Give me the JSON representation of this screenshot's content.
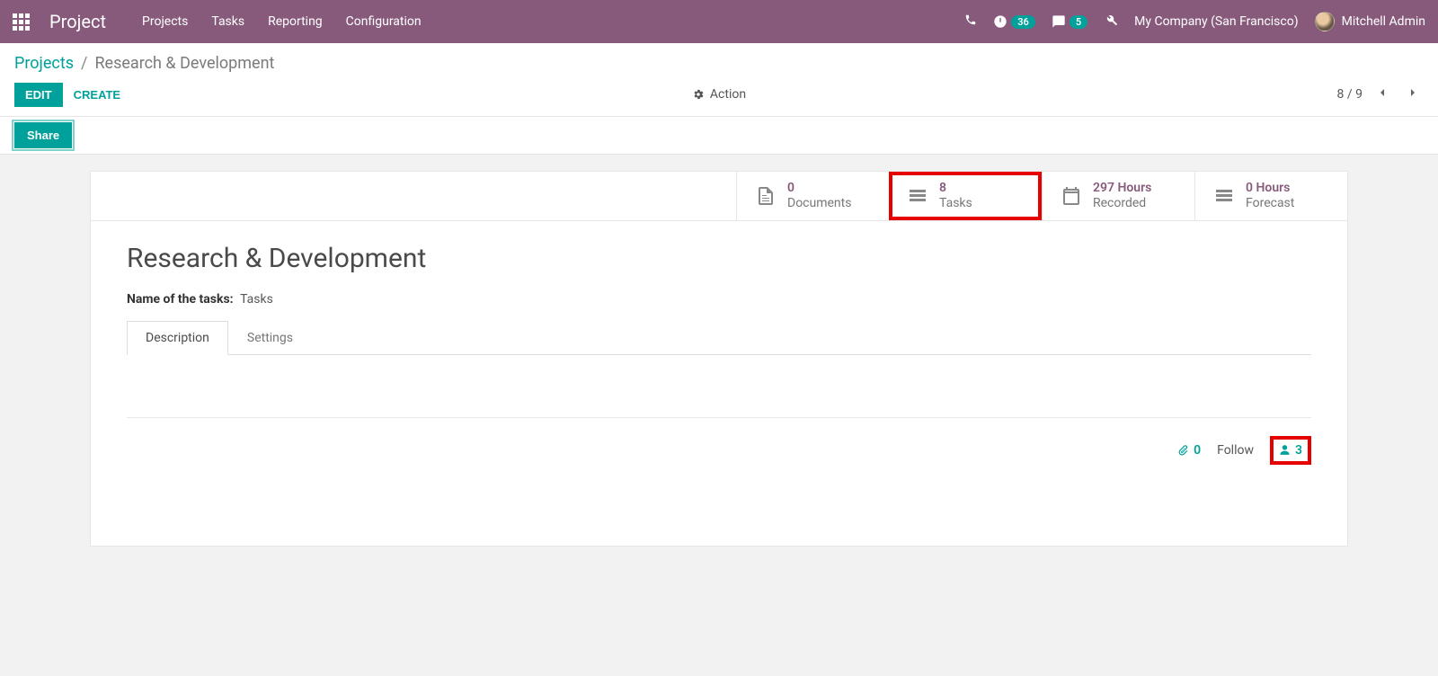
{
  "navbar": {
    "brand": "Project",
    "links": [
      "Projects",
      "Tasks",
      "Reporting",
      "Configuration"
    ],
    "activities_count": "36",
    "messages_count": "5",
    "company": "My Company (San Francisco)",
    "user": "Mitchell Admin"
  },
  "breadcrumb": {
    "root": "Projects",
    "sep": "/",
    "here": "Research & Development"
  },
  "buttons": {
    "edit": "Edit",
    "create": "Create",
    "action": "Action",
    "share": "Share"
  },
  "pager": {
    "pos": "8 / 9"
  },
  "stats": [
    {
      "value": "0",
      "label": "Documents",
      "icon": "file"
    },
    {
      "value": "8",
      "label": "Tasks",
      "icon": "tasks",
      "highlight": true
    },
    {
      "value": "297 Hours",
      "label": "Recorded",
      "icon": "calendar"
    },
    {
      "value": "0 Hours",
      "label": "Forecast",
      "icon": "tasks"
    }
  ],
  "record": {
    "title": "Research & Development",
    "task_label": "Name of the tasks:",
    "task_value": "Tasks"
  },
  "tabs": {
    "description": "Description",
    "settings": "Settings"
  },
  "follow": {
    "attachments": "0",
    "follow_label": "Follow",
    "followers": "3"
  }
}
